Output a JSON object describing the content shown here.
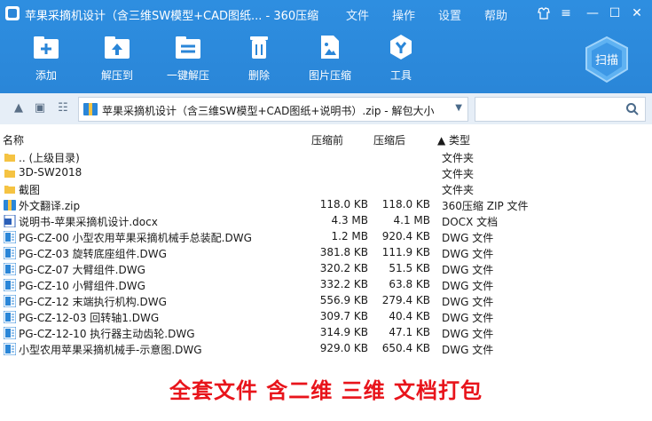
{
  "window": {
    "title": "苹果采摘机设计（含三维SW模型+CAD图纸... - 360压缩",
    "menus": [
      "文件",
      "操作",
      "设置",
      "帮助"
    ]
  },
  "toolbar": {
    "buttons": [
      {
        "label": "添加",
        "icon": "add-icon"
      },
      {
        "label": "解压到",
        "icon": "extract-to-icon"
      },
      {
        "label": "一键解压",
        "icon": "one-click-extract-icon"
      },
      {
        "label": "删除",
        "icon": "delete-icon"
      },
      {
        "label": "图片压缩",
        "icon": "image-compress-icon"
      },
      {
        "label": "工具",
        "icon": "tools-icon"
      }
    ],
    "scan_label": "扫描"
  },
  "address": {
    "path": "苹果采摘机设计（含三维SW模型+CAD图纸+说明书）.zip - 解包大小"
  },
  "columns": {
    "name": "名称",
    "size": "压缩前",
    "compressed": "压缩后",
    "type": "▲ 类型"
  },
  "files": [
    {
      "name": ".. (上级目录)",
      "size": "",
      "compressed": "",
      "type": "文件夹",
      "icon": "folder"
    },
    {
      "name": "3D-SW2018",
      "size": "",
      "compressed": "",
      "type": "文件夹",
      "icon": "folder"
    },
    {
      "name": "截图",
      "size": "",
      "compressed": "",
      "type": "文件夹",
      "icon": "folder"
    },
    {
      "name": "外文翻译.zip",
      "size": "118.0 KB",
      "compressed": "118.0 KB",
      "type": "360压缩 ZIP 文件",
      "icon": "zip"
    },
    {
      "name": "说明书-苹果采摘机设计.docx",
      "size": "4.3 MB",
      "compressed": "4.1 MB",
      "type": "DOCX 文档",
      "icon": "docx"
    },
    {
      "name": "PG-CZ-00 小型农用苹果采摘机械手总装配.DWG",
      "size": "1.2 MB",
      "compressed": "920.4 KB",
      "type": "DWG 文件",
      "icon": "dwg"
    },
    {
      "name": "PG-CZ-03 旋转底座组件.DWG",
      "size": "381.8 KB",
      "compressed": "111.9 KB",
      "type": "DWG 文件",
      "icon": "dwg"
    },
    {
      "name": "PG-CZ-07 大臂组件.DWG",
      "size": "320.2 KB",
      "compressed": "51.5 KB",
      "type": "DWG 文件",
      "icon": "dwg"
    },
    {
      "name": "PG-CZ-10 小臂组件.DWG",
      "size": "332.2 KB",
      "compressed": "63.8 KB",
      "type": "DWG 文件",
      "icon": "dwg"
    },
    {
      "name": "PG-CZ-12 末端执行机构.DWG",
      "size": "556.9 KB",
      "compressed": "279.4 KB",
      "type": "DWG 文件",
      "icon": "dwg"
    },
    {
      "name": "PG-CZ-12-03 回转轴1.DWG",
      "size": "309.7 KB",
      "compressed": "40.4 KB",
      "type": "DWG 文件",
      "icon": "dwg"
    },
    {
      "name": "PG-CZ-12-10 执行器主动齿轮.DWG",
      "size": "314.9 KB",
      "compressed": "47.1 KB",
      "type": "DWG 文件",
      "icon": "dwg"
    },
    {
      "name": "小型农用苹果采摘机械手-示意图.DWG",
      "size": "929.0 KB",
      "compressed": "650.4 KB",
      "type": "DWG 文件",
      "icon": "dwg"
    }
  ],
  "caption": "全套文件 含二维 三维 文档打包",
  "colors": {
    "accent": "#2a86d8",
    "caption": "#e8141b",
    "folder": "#f5c342"
  }
}
